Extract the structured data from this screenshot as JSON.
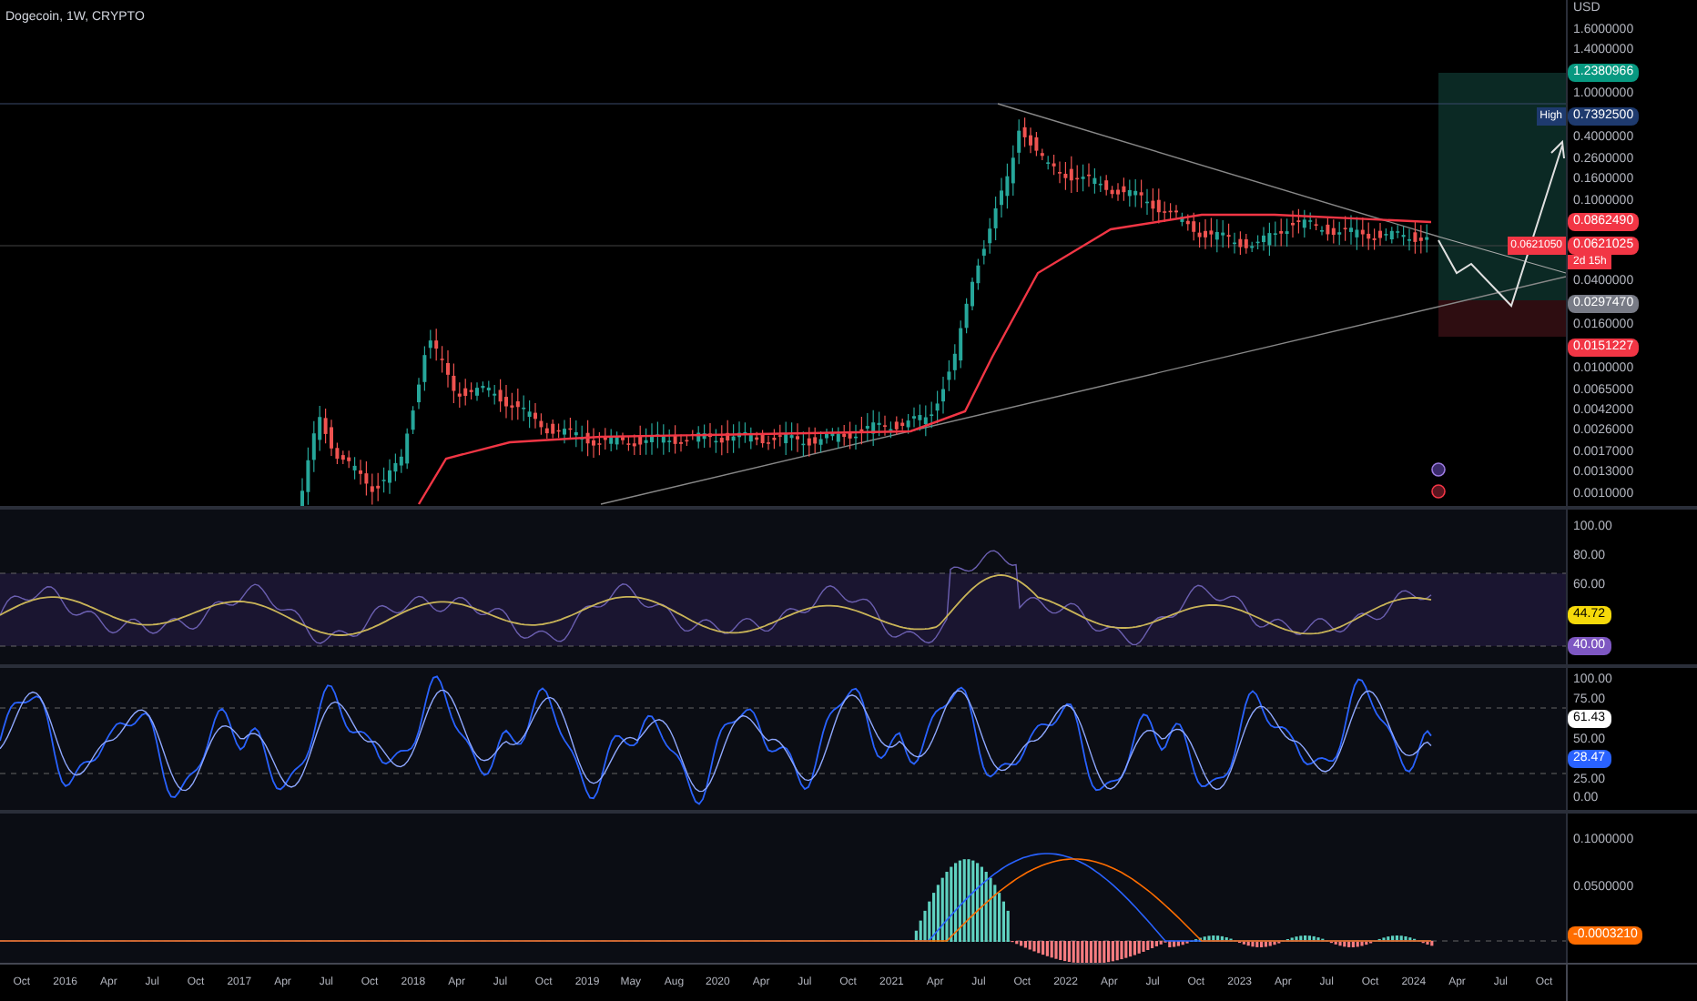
{
  "header": {
    "title": "Dogecoin, 1W, CRYPTO"
  },
  "price_axis": {
    "currency": "USD",
    "labels": [
      {
        "text": "1.6000000",
        "kind": "tick"
      },
      {
        "text": "1.4000000",
        "kind": "tick"
      },
      {
        "text": "1.2380966",
        "kind": "badge",
        "color": "#089981"
      },
      {
        "text": "1.0000000",
        "kind": "tick"
      },
      {
        "text": "0.7392500",
        "kind": "badge",
        "color": "#1e3a6e",
        "tag": "High"
      },
      {
        "text": "0.4000000",
        "kind": "tick"
      },
      {
        "text": "0.2600000",
        "kind": "tick"
      },
      {
        "text": "0.1600000",
        "kind": "tick"
      },
      {
        "text": "0.1000000",
        "kind": "tick"
      },
      {
        "text": "0.0862490",
        "kind": "badge",
        "color": "#f23645"
      },
      {
        "text": "0.0621025",
        "subtext": "2d 15h",
        "kind": "badge",
        "color": "#f23645",
        "tag": "0.0621050"
      },
      {
        "text": "0.0400000",
        "kind": "tick"
      },
      {
        "text": "0.0297470",
        "kind": "badge",
        "color": "#787b86"
      },
      {
        "text": "0.0160000",
        "kind": "tick"
      },
      {
        "text": "0.0151227",
        "kind": "badge",
        "color": "#f23645"
      },
      {
        "text": "0.0100000",
        "kind": "tick"
      },
      {
        "text": "0.0065000",
        "kind": "tick"
      },
      {
        "text": "0.0042000",
        "kind": "tick"
      },
      {
        "text": "0.0026000",
        "kind": "tick"
      },
      {
        "text": "0.0017000",
        "kind": "tick"
      },
      {
        "text": "0.0013000",
        "kind": "tick"
      },
      {
        "text": "0.0010000",
        "kind": "tick"
      }
    ]
  },
  "rsi_axis": {
    "labels": [
      {
        "text": "100.00",
        "kind": "tick"
      },
      {
        "text": "80.00",
        "kind": "tick"
      },
      {
        "text": "60.00",
        "kind": "tick"
      },
      {
        "text": "44.72",
        "kind": "badge",
        "color": "#f5d90a"
      },
      {
        "text": "40.00",
        "kind": "badge",
        "color": "#7e57c2"
      }
    ]
  },
  "stoch_axis": {
    "labels": [
      {
        "text": "100.00",
        "kind": "tick"
      },
      {
        "text": "75.00",
        "kind": "tick"
      },
      {
        "text": "61.43",
        "kind": "badge",
        "color": "#ffffff"
      },
      {
        "text": "50.00",
        "kind": "tick"
      },
      {
        "text": "28.47",
        "kind": "badge",
        "color": "#2962ff"
      },
      {
        "text": "25.00",
        "kind": "tick"
      },
      {
        "text": "0.00",
        "kind": "tick"
      }
    ]
  },
  "macd_axis": {
    "labels": [
      {
        "text": "0.1000000",
        "kind": "tick"
      },
      {
        "text": "0.0500000",
        "kind": "tick"
      },
      {
        "text": "-0.0003210",
        "kind": "badge",
        "color": "#ff6d00"
      }
    ]
  },
  "time_axis": [
    "Oct",
    "2016",
    "Apr",
    "Jul",
    "Oct",
    "2017",
    "Apr",
    "Jul",
    "Oct",
    "2018",
    "Apr",
    "Jul",
    "Oct",
    "2019",
    "May",
    "Aug",
    "2020",
    "Apr",
    "Jul",
    "Oct",
    "2021",
    "Apr",
    "Jul",
    "Oct",
    "2022",
    "Apr",
    "Jul",
    "Oct",
    "2023",
    "Apr",
    "Jul",
    "Oct",
    "2024",
    "Apr",
    "Jul",
    "Oct"
  ]
}
